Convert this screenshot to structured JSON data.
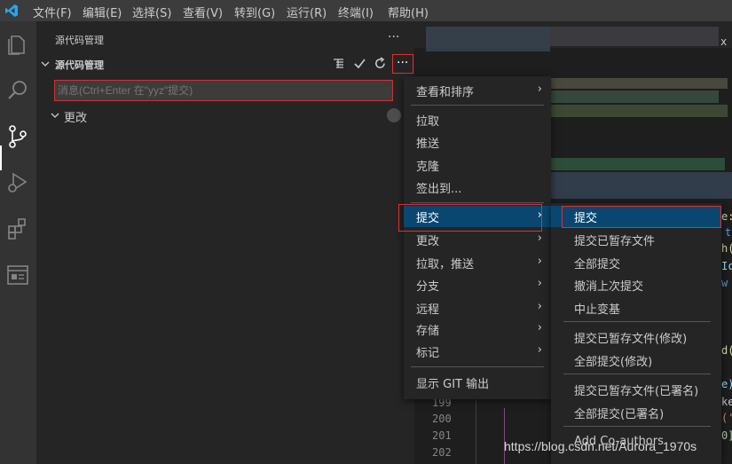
{
  "titlebar": {
    "menus": [
      "文件(F)",
      "编辑(E)",
      "选择(S)",
      "查看(V)",
      "转到(G)",
      "运行(R)",
      "终端(I)",
      "帮助(H)"
    ]
  },
  "activity": {
    "icons": [
      "explorer-icon",
      "search-icon",
      "source-control-icon",
      "run-debug-icon",
      "extensions-icon",
      "remote-explorer-icon"
    ]
  },
  "sidebar": {
    "title": "源代码管理",
    "more": "···",
    "section_title": "源代码管理",
    "commit_placeholder": "消息(Ctrl+Enter 在\"yyz\"提交)",
    "changes_label": "更改"
  },
  "context_menu": {
    "items": [
      "查看和排序",
      "拉取",
      "推送",
      "克隆",
      "签出到...",
      "提交",
      "更改",
      "拉取，推送",
      "分支",
      "远程",
      "存储",
      "标记",
      "显示 GIT 输出"
    ]
  },
  "submenu": {
    "items": [
      "提交",
      "提交已暂存文件",
      "全部提交",
      "撤消上次提交",
      "中止变基",
      "提交已暂存文件(修改)",
      "全部提交(修改)",
      "提交已暂存文件(已署名)",
      "全部提交(已署名)",
      "Add Co-authors"
    ]
  },
  "editor": {
    "line_numbers": [
      "199",
      "200",
      "201",
      "202"
    ],
    "code_fragments": [
      "e:",
      "t",
      "h(",
      "Ic",
      "w",
      "d(",
      "e)",
      "ke",
      "('",
      "0]"
    ],
    "right_edge_text": "x"
  },
  "watermark": "https://blog.csdn.net/Aurora_1970s"
}
